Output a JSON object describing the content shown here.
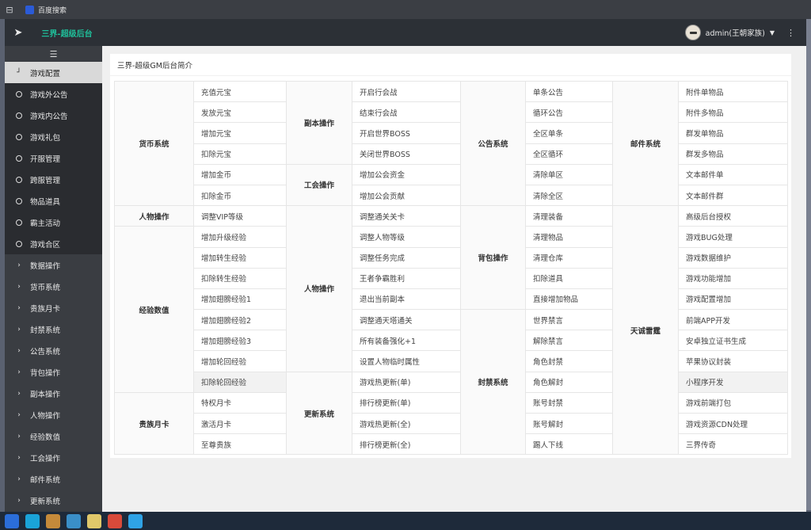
{
  "browser": {
    "tab_title": "百度搜索",
    "colors": {
      "tabbar": "#3b3e44",
      "favicon": "#2b5bd7"
    }
  },
  "header": {
    "brand": "三界-超级后台",
    "user": "admin(王朝家族)",
    "colors": {
      "brand": "#1fbf9a",
      "topbar": "#2c3036"
    }
  },
  "sidebar": {
    "items": [
      {
        "label": "游戏配置",
        "kind": "active"
      },
      {
        "label": "游戏外公告",
        "kind": "sub"
      },
      {
        "label": "游戏内公告",
        "kind": "sub"
      },
      {
        "label": "游戏礼包",
        "kind": "sub"
      },
      {
        "label": "开服管理",
        "kind": "sub"
      },
      {
        "label": "跨服管理",
        "kind": "sub"
      },
      {
        "label": "物品道具",
        "kind": "sub"
      },
      {
        "label": "霸主活动",
        "kind": "sub"
      },
      {
        "label": "游戏合区",
        "kind": "sub"
      },
      {
        "label": "数据操作",
        "kind": "group"
      },
      {
        "label": "货币系统",
        "kind": "group"
      },
      {
        "label": "贵族月卡",
        "kind": "group"
      },
      {
        "label": "封禁系统",
        "kind": "group"
      },
      {
        "label": "公告系统",
        "kind": "group"
      },
      {
        "label": "背包操作",
        "kind": "group"
      },
      {
        "label": "副本操作",
        "kind": "group"
      },
      {
        "label": "人物操作",
        "kind": "group"
      },
      {
        "label": "经验数值",
        "kind": "group"
      },
      {
        "label": "工会操作",
        "kind": "group"
      },
      {
        "label": "邮件系统",
        "kind": "group"
      },
      {
        "label": "更新系统",
        "kind": "group"
      }
    ]
  },
  "main": {
    "title": "三界-超级GM后台简介",
    "cats": {
      "c1": "货币系统",
      "c2": "人物操作",
      "c3": "经验数值",
      "c4": "贵族月卡",
      "d1": "副本操作",
      "d2": "工会操作",
      "d3": "人物操作",
      "d4": "更新系统",
      "e1": "公告系统",
      "e2": "背包操作",
      "e3": "封禁系统",
      "f1": "邮件系统",
      "f2": "天诚雷霆"
    },
    "col1": [
      "充值元宝",
      "发放元宝",
      "增加元宝",
      "扣除元宝",
      "增加金币",
      "扣除金币",
      "调整VIP等级",
      "增加升级经验",
      "增加转生经验",
      "扣除转生经验",
      "增加翅膀经验1",
      "增加翅膀经验2",
      "增加翅膀经验3",
      "增加轮回经验",
      "扣除轮回经验",
      "特权月卡",
      "激活月卡",
      "至尊贵族"
    ],
    "col2": [
      "开启行会战",
      "结束行会战",
      "开启世界BOSS",
      "关闭世界BOSS",
      "增加公会资金",
      "增加公会贡献",
      "调整通关关卡",
      "调整人物等级",
      "调整任务完成",
      "王者争霸胜利",
      "退出当前副本",
      "调整通天塔通关",
      "所有装备强化+1",
      "设置人物临时属性",
      "游戏热更新(单)",
      "排行榜更新(单)",
      "游戏热更新(全)",
      "排行榜更新(全)"
    ],
    "col3": [
      "单条公告",
      "循环公告",
      "全区单条",
      "全区循环",
      "清除单区",
      "清除全区",
      "清理装备",
      "清理物品",
      "清理仓库",
      "扣除道具",
      "直接增加物品",
      "世界禁言",
      "解除禁言",
      "角色封禁",
      "角色解封",
      "账号封禁",
      "账号解封",
      "踢人下线"
    ],
    "col4": [
      "附件单物品",
      "附件多物品",
      "群发单物品",
      "群发多物品",
      "文本邮件单",
      "文本邮件群",
      "高级后台授权",
      "游戏BUG处理",
      "游戏数据维护",
      "游戏功能增加",
      "游戏配置增加",
      "前端APP开发",
      "安卓独立证书生成",
      "苹果协议封装",
      "小程序开发",
      "游戏前端打包",
      "游戏资源CDN处理",
      "三界传奇"
    ]
  }
}
